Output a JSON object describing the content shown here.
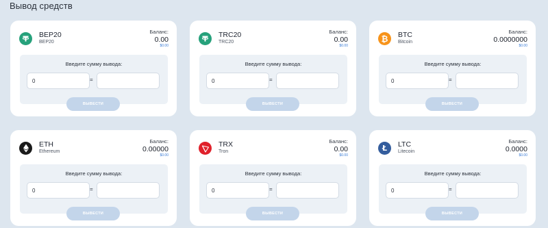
{
  "page": {
    "title": "Вывод средств"
  },
  "labels": {
    "balance": "Баланс:",
    "enter_amount": "Введите сумму вывода:",
    "equals": "=",
    "withdraw": "ВЫВЕСТИ"
  },
  "cards": [
    {
      "ticker": "BEP20",
      "name": "BEP20",
      "balance": "0.00",
      "usd": "$0.00",
      "icon": "tether-icon",
      "color": "#26a17b",
      "amount": "0",
      "converted": ""
    },
    {
      "ticker": "TRC20",
      "name": "TRC20",
      "balance": "0.00",
      "usd": "$0.00",
      "icon": "tether-icon",
      "color": "#26a17b",
      "amount": "0",
      "converted": ""
    },
    {
      "ticker": "BTC",
      "name": "Bitcoin",
      "balance": "0.0000000",
      "usd": "$0.00",
      "icon": "bitcoin-icon",
      "color": "#f7931a",
      "amount": "0",
      "converted": ""
    },
    {
      "ticker": "ETH",
      "name": "Ethereum",
      "balance": "0.00000",
      "usd": "$0.00",
      "icon": "ethereum-icon",
      "color": "#1a1a1a",
      "amount": "0",
      "converted": ""
    },
    {
      "ticker": "TRX",
      "name": "Tron",
      "balance": "0.00",
      "usd": "$0.00",
      "icon": "tron-icon",
      "color": "#e0212b",
      "amount": "0",
      "converted": ""
    },
    {
      "ticker": "LTC",
      "name": "Litecoin",
      "balance": "0.0000",
      "usd": "$0.00",
      "icon": "litecoin-icon",
      "color": "#345d9d",
      "amount": "0",
      "converted": ""
    }
  ]
}
